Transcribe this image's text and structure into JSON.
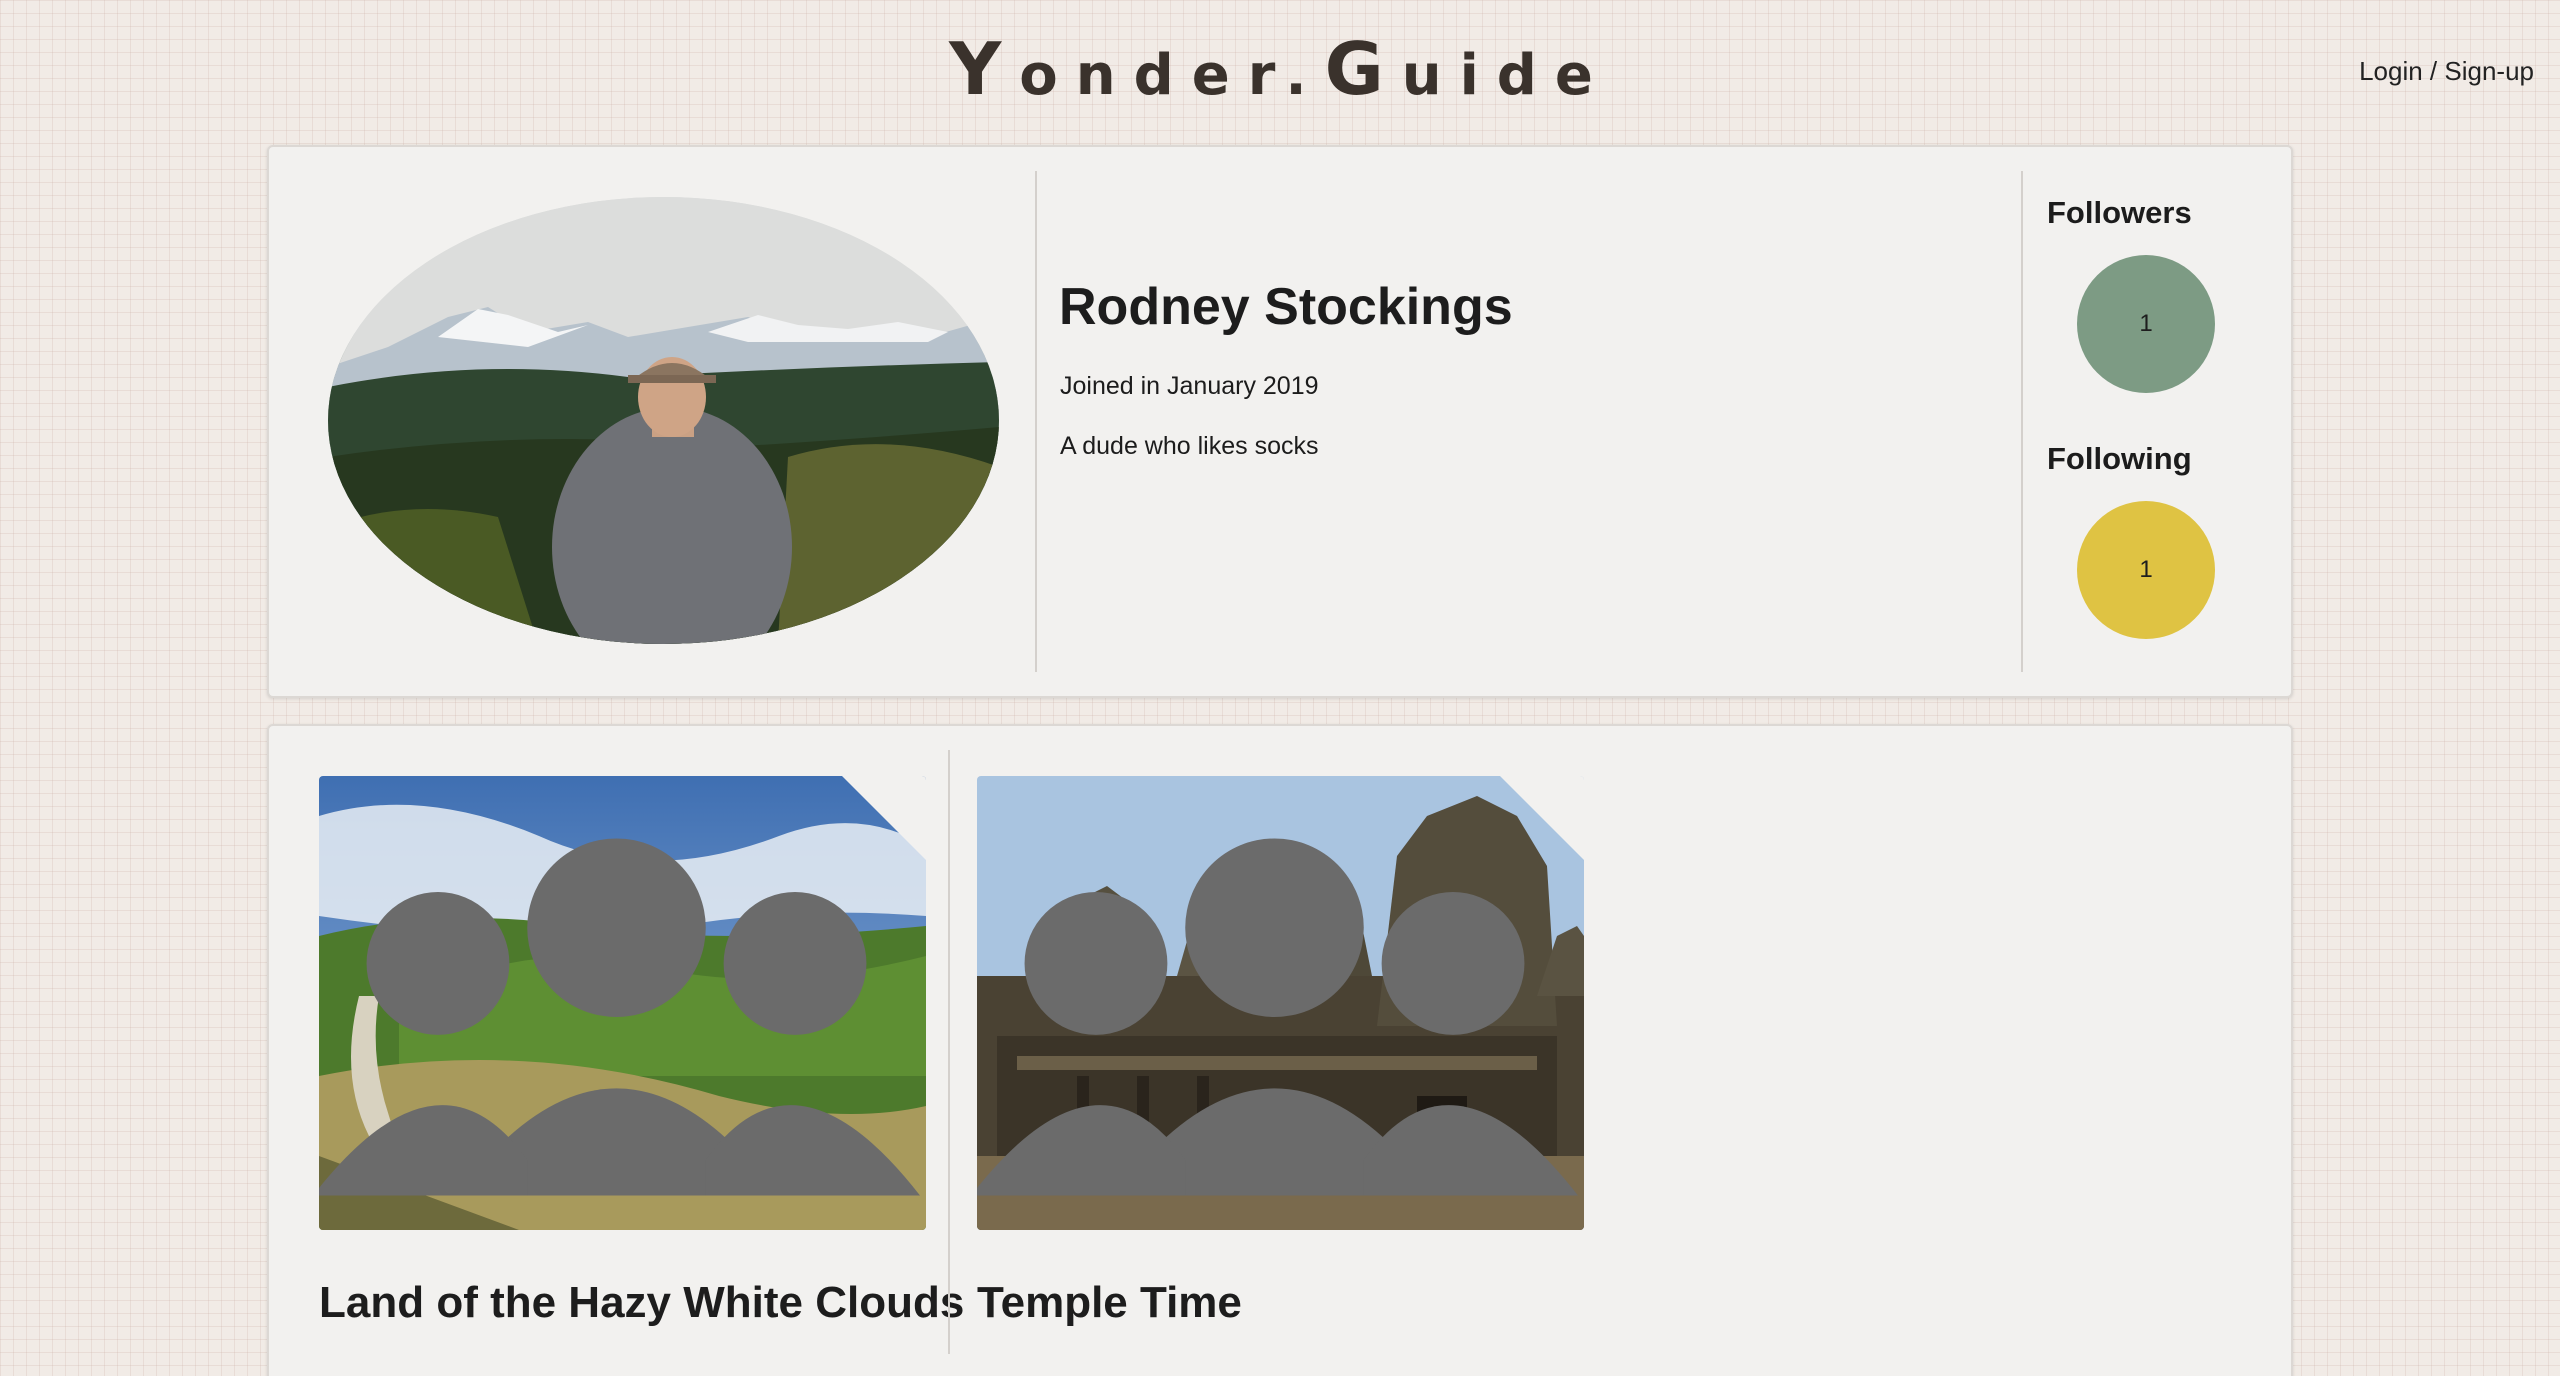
{
  "header": {
    "logo_parts": [
      "Y",
      "onder.",
      "G",
      "uide"
    ],
    "login_label": "Login / Sign-up"
  },
  "profile": {
    "name": "Rodney Stockings",
    "joined": "Joined in January 2019",
    "bio": "A dude who likes socks",
    "followers_label": "Followers",
    "followers_count": "1",
    "following_label": "Following",
    "following_count": "1",
    "colors": {
      "followers": "#7d9b84",
      "following": "#dfc343"
    }
  },
  "trips": [
    {
      "title": "Land of the Hazy White Clouds",
      "icon": "group-icon"
    },
    {
      "title": "Temple Time",
      "icon": "group-icon"
    }
  ]
}
